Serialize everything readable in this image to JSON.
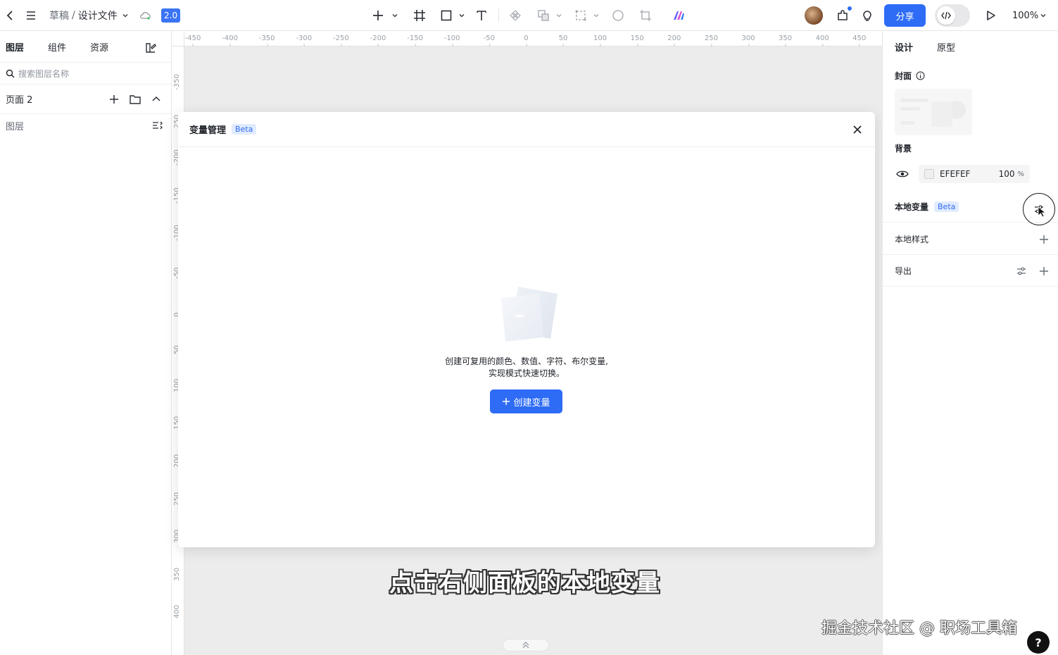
{
  "topbar": {
    "breadcrumb_draft": "草稿",
    "breadcrumb_sep": "/",
    "file_name": "设计文件",
    "version_badge": "2.0",
    "share_label": "分享",
    "zoom_label": "100%"
  },
  "left_panel": {
    "tabs": [
      "图层",
      "组件",
      "资源"
    ],
    "search_placeholder": "搜索图层名称",
    "page_name": "页面 2",
    "layers_label": "图层"
  },
  "rulers": {
    "h_ticks": [
      "-450",
      "-400",
      "-350",
      "-300",
      "-250",
      "-200",
      "-150",
      "-100",
      "-50",
      "0",
      "50",
      "100",
      "150",
      "200",
      "250",
      "300",
      "350",
      "400",
      "450"
    ],
    "v_ticks": [
      "-350",
      "250",
      "-200",
      "-150",
      "-100",
      "-50",
      "0",
      "50",
      "100",
      "150",
      "200",
      "250",
      "300",
      "350",
      "400"
    ]
  },
  "modal": {
    "title": "变量管理",
    "beta": "Beta",
    "empty_line1": "创建可复用的颜色、数值、字符、布尔变量,",
    "empty_line2": "实现模式快速切换。",
    "create_button": "创建变量"
  },
  "right_panel": {
    "tabs": [
      "设计",
      "原型"
    ],
    "cover_label": "封面",
    "background_label": "背景",
    "background_hex": "EFEFEF",
    "background_opacity": "100",
    "background_opacity_unit": "%",
    "local_variables_label": "本地变量",
    "local_variables_beta": "Beta",
    "local_styles_label": "本地样式",
    "export_label": "导出"
  },
  "overlay": {
    "subtitle": "点击右侧面板的本地变量",
    "watermark": "掘金技术社区 @ 职场工具箱",
    "help": "?"
  },
  "colors": {
    "accent": "#2e6cf6",
    "canvas_bg": "#ececec"
  }
}
